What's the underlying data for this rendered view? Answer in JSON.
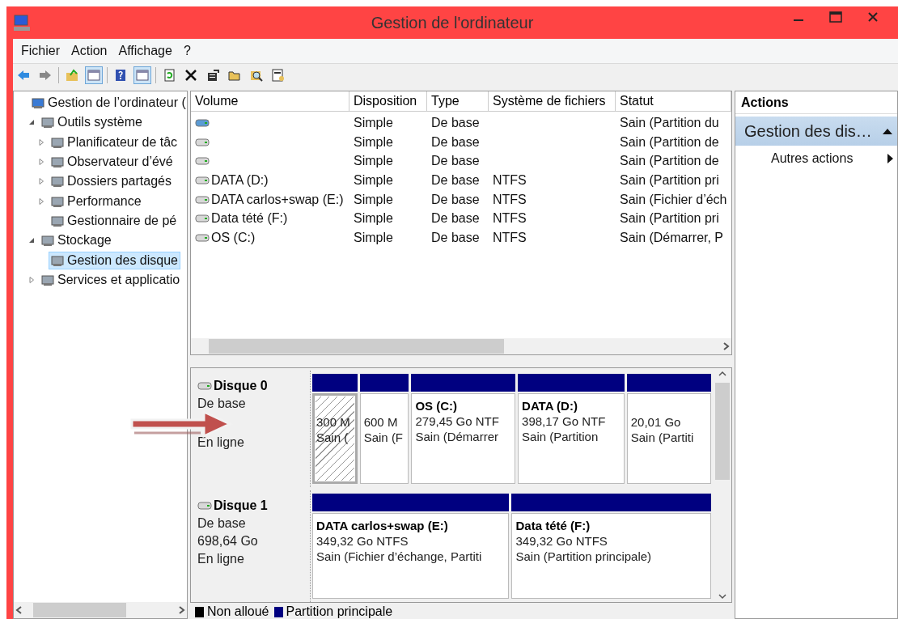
{
  "window": {
    "title": "Gestion de l'ordinateur"
  },
  "menu": [
    "Fichier",
    "Action",
    "Affichage",
    "?"
  ],
  "toolbar": [
    {
      "pressed": false
    },
    {
      "pressed": false
    },
    {
      "pressed": false
    },
    {
      "pressed": true
    },
    {
      "pressed": false
    },
    {
      "pressed": true
    },
    {
      "pressed": false
    },
    {
      "pressed": false
    },
    {
      "pressed": false
    },
    {
      "pressed": false
    },
    {
      "pressed": false
    },
    {
      "pressed": false
    }
  ],
  "tree": [
    {
      "label": "Gestion de l’ordinateur (",
      "selected": false,
      "children": [
        {
          "label": "Outils système",
          "expanded": true,
          "selected": false,
          "children": [
            {
              "label": "Planificateur de tâc",
              "expanded": false,
              "selected": false
            },
            {
              "label": "Observateur d’évé",
              "expanded": false,
              "selected": false
            },
            {
              "label": "Dossiers partagés",
              "expanded": false,
              "selected": false
            },
            {
              "label": "Performance",
              "expanded": false,
              "selected": false
            },
            {
              "label": "Gestionnaire de pé",
              "selected": false
            }
          ]
        },
        {
          "label": "Stockage",
          "expanded": true,
          "selected": false,
          "children": [
            {
              "label": "Gestion des disque",
              "selected": true
            }
          ]
        },
        {
          "label": "Services et applicatio",
          "expanded": false,
          "selected": false
        }
      ]
    }
  ],
  "volumes": {
    "columns": [
      "Volume",
      "Disposition",
      "Type",
      "Système de fichiers",
      "Statut"
    ],
    "rows": [
      [
        "",
        "Simple",
        "De base",
        "",
        "Sain (Partition du"
      ],
      [
        "",
        "Simple",
        "De base",
        "",
        "Sain (Partition de"
      ],
      [
        "",
        "Simple",
        "De base",
        "",
        "Sain (Partition de"
      ],
      [
        "DATA  (D:)",
        "Simple",
        "De base",
        "NTFS",
        "Sain (Partition pri"
      ],
      [
        "DATA carlos+swap (E:)",
        "Simple",
        "De base",
        "NTFS",
        "Sain (Fichier d’éch"
      ],
      [
        "Data tété (F:)",
        "Simple",
        "De base",
        "NTFS",
        "Sain (Partition pri"
      ],
      [
        "OS (C:)",
        "Simple",
        "De base",
        "NTFS",
        "Sain (Démarrer, P"
      ]
    ]
  },
  "disks": [
    {
      "name": "Disque 0",
      "lines": [
        "De base",
        "En ligne"
      ],
      "partitions": [
        {
          "lines": [
            "300 M",
            "Sain ("
          ],
          "selected": true
        },
        {
          "lines": [
            "600 M",
            "Sain (F"
          ],
          "selected": false
        },
        {
          "title": "OS  (C:)",
          "lines": [
            "279,45 Go NTF",
            "Sain (Démarrer"
          ],
          "selected": false
        },
        {
          "title": "DATA   (D:)",
          "lines": [
            "398,17 Go NTF",
            "Sain (Partition"
          ],
          "selected": false
        },
        {
          "lines": [
            "20,01 Go",
            "Sain (Partiti"
          ],
          "selected": false
        }
      ]
    },
    {
      "name": "Disque 1",
      "lines": [
        "De base",
        "698,64 Go",
        "En ligne"
      ],
      "partitions": [
        {
          "title": "DATA carlos+swap  (E:)",
          "lines": [
            "349,32 Go NTFS",
            "Sain (Fichier d’échange, Partiti"
          ],
          "selected": false
        },
        {
          "title": "Data tété  (F:)",
          "lines": [
            "349,32 Go NTFS",
            "Sain (Partition principale)"
          ],
          "selected": false
        }
      ]
    }
  ],
  "legend": [
    {
      "label": "Non alloué",
      "color": "#000000"
    },
    {
      "label": "Partition principale",
      "color": "#000080"
    }
  ],
  "actions": {
    "title": "Actions",
    "section": "Gestion des dis…",
    "items": [
      "Autres actions"
    ]
  }
}
